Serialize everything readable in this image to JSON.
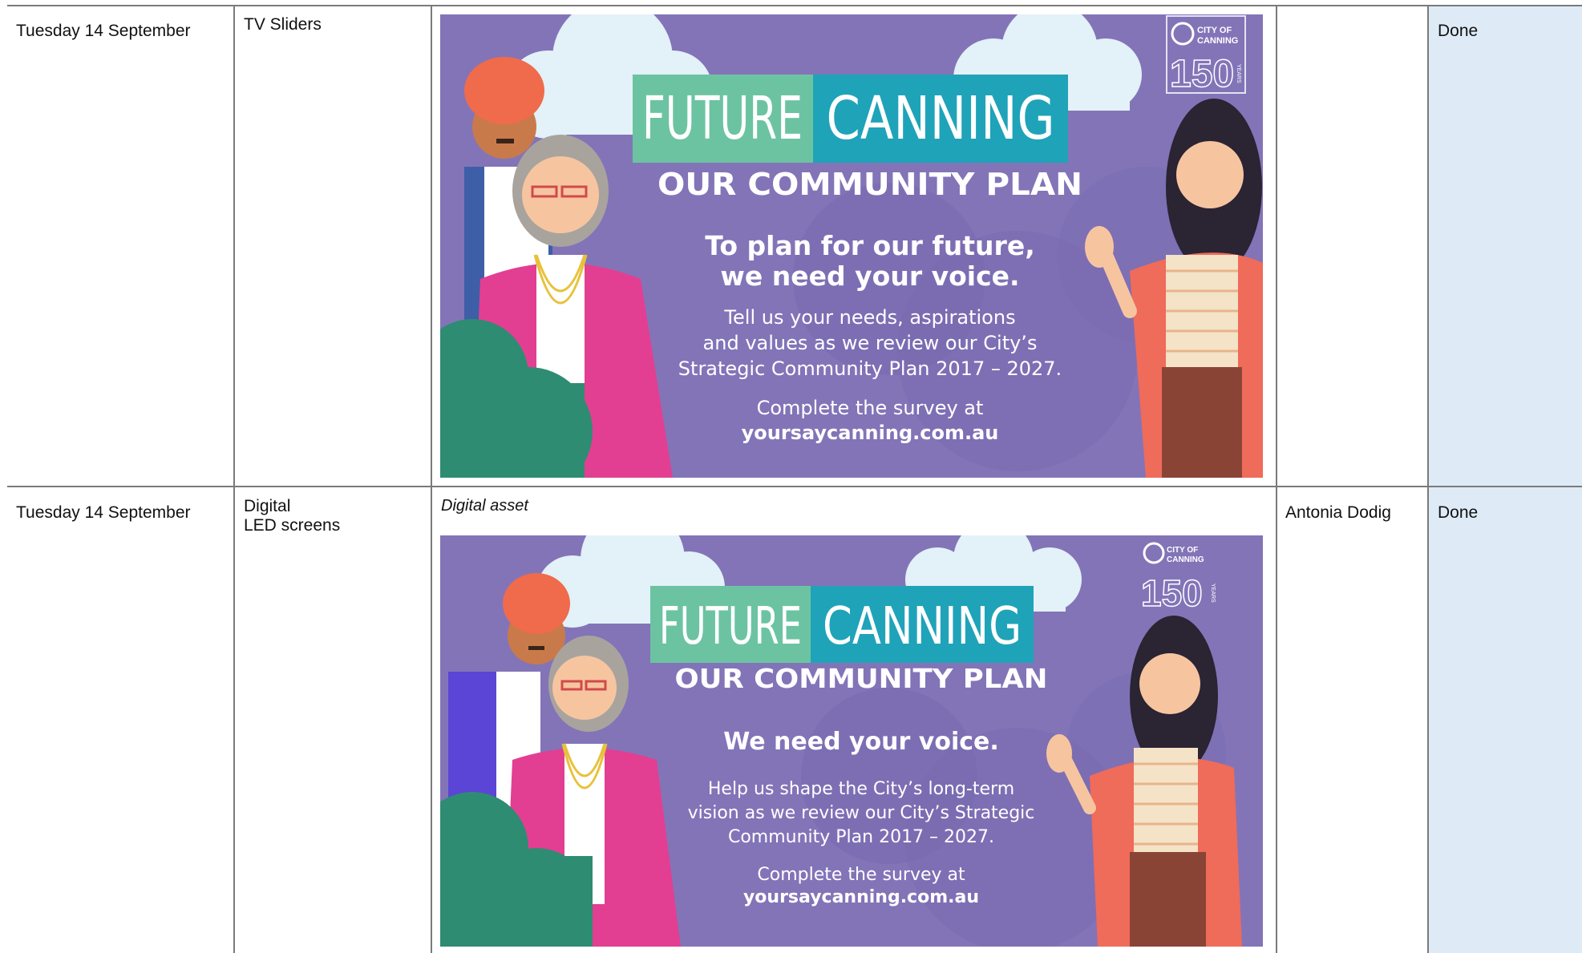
{
  "rows": [
    {
      "date": "Tuesday 14 September",
      "channel": "TV Sliders",
      "caption": "",
      "contact": "",
      "status": "Done",
      "poster": {
        "title_left": "FUTURE",
        "title_right": "CANNING",
        "subtitle": "OUR COMMUNITY PLAN",
        "heading_lines": [
          "To plan for our future,",
          "we need your voice."
        ],
        "body_lines": [
          "Tell us your needs, aspirations",
          "and values as we review our City’s",
          "Strategic Community Plan 2017 – 2027."
        ],
        "cta_line": "Complete the survey at",
        "url": "yoursaycanning.com.au",
        "logo_text_1": "CITY OF",
        "logo_text_2": "CANNING",
        "logo_number": "150",
        "logo_years": "YEARS"
      }
    },
    {
      "date": "Tuesday 14 September",
      "channel": "Digital\nLED screens",
      "caption": "Digital asset",
      "contact": "Antonia Dodig",
      "status": "Done",
      "poster": {
        "title_left": "FUTURE",
        "title_right": "CANNING",
        "subtitle": "OUR COMMUNITY PLAN",
        "heading_lines": [
          "We need your voice."
        ],
        "body_lines": [
          "Help us shape the City’s long-term",
          "vision as we review our City’s Strategic",
          "Community Plan 2017 – 2027."
        ],
        "cta_line": "Complete the survey at",
        "url": "yoursaycanning.com.au",
        "logo_text_1": "CITY OF",
        "logo_text_2": "CANNING",
        "logo_number": "150",
        "logo_years": "YEARS"
      }
    }
  ],
  "colors": {
    "poster_bg": "#8374b8",
    "title_green": "#6cc3a2",
    "title_teal": "#1fa3b9",
    "status_column": "#deebf7"
  }
}
